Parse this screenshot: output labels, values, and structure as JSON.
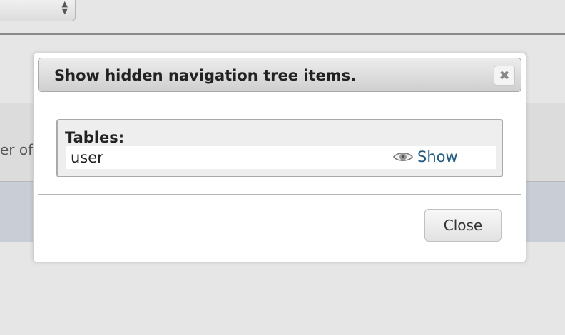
{
  "background": {
    "partial_text": "er of c"
  },
  "dialog": {
    "title": "Show hidden navigation tree items.",
    "close_icon_glyph": "✖",
    "section_label": "Tables:",
    "items": [
      {
        "name": "user",
        "action_label": "Show",
        "action_icon": "eye-icon"
      }
    ],
    "close_button_label": "Close"
  },
  "colors": {
    "link": "#235a81",
    "row_highlight": "#c9cdd6"
  }
}
